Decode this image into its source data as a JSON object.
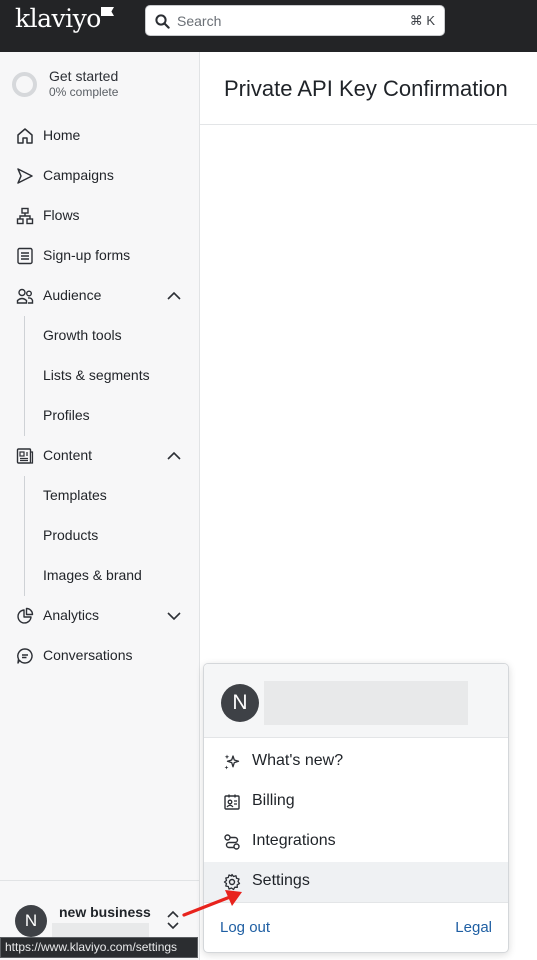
{
  "app": {
    "logo_text": "klaviyo"
  },
  "search": {
    "placeholder": "Search",
    "shortcut": "⌘ K"
  },
  "sidebar": {
    "get_started": {
      "title": "Get started",
      "progress": "0% complete",
      "progress_value": 0
    },
    "items": [
      {
        "label": "Home",
        "icon": "home-icon"
      },
      {
        "label": "Campaigns",
        "icon": "send-icon"
      },
      {
        "label": "Flows",
        "icon": "flow-icon"
      },
      {
        "label": "Sign-up forms",
        "icon": "form-icon"
      },
      {
        "label": "Audience",
        "icon": "people-icon",
        "expanded": true,
        "children": [
          "Growth tools",
          "Lists & segments",
          "Profiles"
        ]
      },
      {
        "label": "Content",
        "icon": "content-icon",
        "expanded": true,
        "children": [
          "Templates",
          "Products",
          "Images & brand"
        ]
      },
      {
        "label": "Analytics",
        "icon": "chart-icon",
        "expanded": false
      },
      {
        "label": "Conversations",
        "icon": "chat-icon"
      }
    ],
    "footer": {
      "avatar_initial": "N",
      "account_name": "new business"
    },
    "url_tooltip": "https://www.klaviyo.com/settings"
  },
  "main": {
    "title": "Private API Key Confirmation"
  },
  "account_menu": {
    "avatar_initial": "N",
    "items": [
      {
        "label": "What's new?",
        "icon": "sparkle-icon"
      },
      {
        "label": "Billing",
        "icon": "billing-icon"
      },
      {
        "label": "Integrations",
        "icon": "integrations-icon"
      },
      {
        "label": "Settings",
        "icon": "gear-icon",
        "active": true
      }
    ],
    "logout_label": "Log out",
    "legal_label": "Legal"
  },
  "colors": {
    "topbar": "#232426",
    "sidebar_bg": "#f7f7f8",
    "link": "#1f5fa3",
    "annotation_arrow": "#e8231d"
  }
}
